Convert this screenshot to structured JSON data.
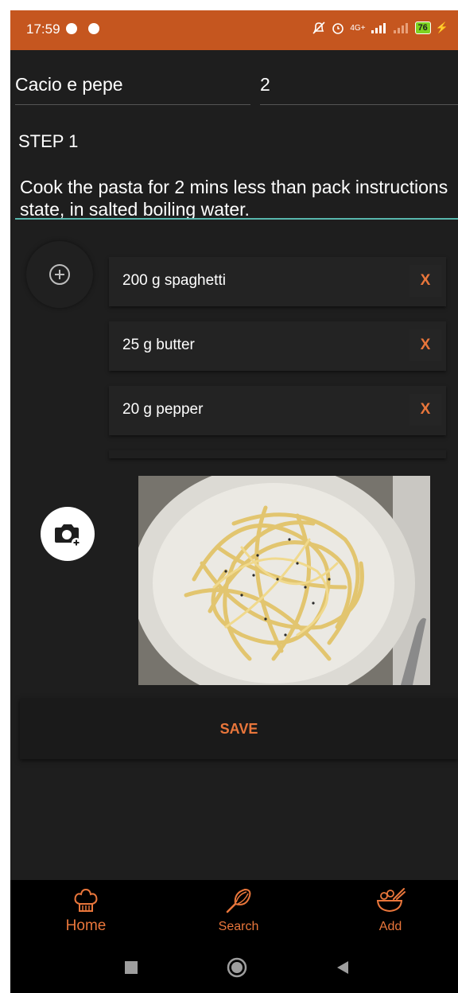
{
  "status_bar": {
    "time": "17:59",
    "network": "4G+",
    "battery": "76"
  },
  "recipe": {
    "name": "Cacio e pepe",
    "servings": "2",
    "step_title": "STEP 1",
    "step_text": "Cook the pasta for 2 mins less than pack instructions state, in salted boiling water."
  },
  "ingredients": [
    {
      "text": "200 g spaghetti",
      "delete_label": "X"
    },
    {
      "text": "25 g butter",
      "delete_label": "X"
    },
    {
      "text": "20 g pepper",
      "delete_label": "X"
    }
  ],
  "save_label": "SAVE",
  "bottom_nav": {
    "items": [
      {
        "label": "Home",
        "icon": "chef-hat-icon",
        "active": true
      },
      {
        "label": "Search",
        "icon": "whisk-icon",
        "active": false
      },
      {
        "label": "Add",
        "icon": "bowl-icon",
        "active": false
      }
    ]
  },
  "colors": {
    "accent": "#e9763b",
    "status_bar": "#c5561f",
    "background": "#1e1e1e",
    "input_underline": "#58b7ad"
  }
}
